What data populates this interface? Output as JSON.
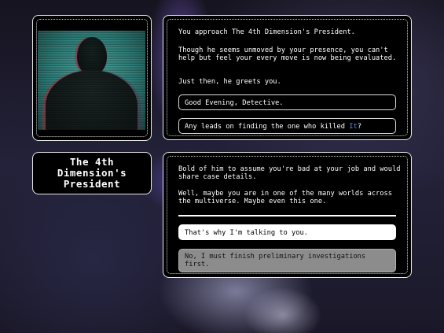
{
  "character": {
    "name_line1": "The 4th",
    "name_line2": "Dimension's",
    "name_line3": "President"
  },
  "dialog1": {
    "p1": "You approach The 4th Dimension's President.",
    "p2": "Though he seems unmoved by your presence, you can't help but feel your every move is now being evaluated.",
    "p3": "Just then, he greets you.",
    "option1": "Good Evening, Detective.",
    "option2_before": "Any leads on finding the one who killed ",
    "option2_highlight": "It",
    "option2_after": "?"
  },
  "dialog2": {
    "p1": "Bold of him to assume you're bad at your job and would share case details.",
    "p2": "Well, maybe you are in one of the many worlds across the multiverse. Maybe even this one.",
    "choice_selected": "That's why I'm talking to you.",
    "choice_disabled": "No, I must finish preliminary investigations first."
  },
  "colors": {
    "highlight": "#5b8cff",
    "portrait_teal": "#4fa59e",
    "selected_bg": "#ffffff",
    "disabled_bg": "#8c8c8c"
  }
}
